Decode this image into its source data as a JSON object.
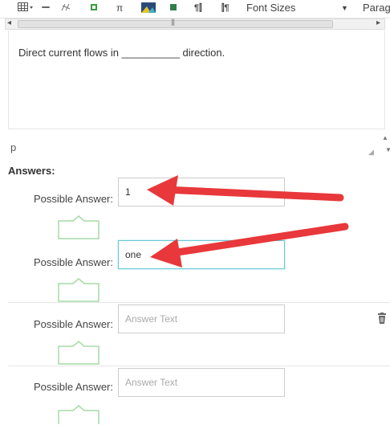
{
  "toolbar": {
    "font_sizes_label": "Font Sizes",
    "paragraph_label": "Parag",
    "icons": [
      "table-icon",
      "link-icon",
      "unlink-icon",
      "image-icon",
      "pi-icon",
      "media-icon",
      "template-icon",
      "ltr-icon",
      "rtl-icon"
    ]
  },
  "editor": {
    "content": "Direct current flows in __________ direction.",
    "path": "p"
  },
  "answers": {
    "heading": "Answers:",
    "items": [
      {
        "label": "Possible Answer:",
        "value": "1",
        "placeholder": "Answer Text"
      },
      {
        "label": "Possible Answer:",
        "value": "one",
        "placeholder": "Answer Text"
      },
      {
        "label": "Possible Answer:",
        "value": "",
        "placeholder": "Answer Text"
      },
      {
        "label": "Possible Answer:",
        "value": "",
        "placeholder": "Answer Text"
      }
    ]
  },
  "colors": {
    "arrow": "#e8383b",
    "focus_border": "#66c7d6",
    "drop_shape": "#a6dba6"
  }
}
